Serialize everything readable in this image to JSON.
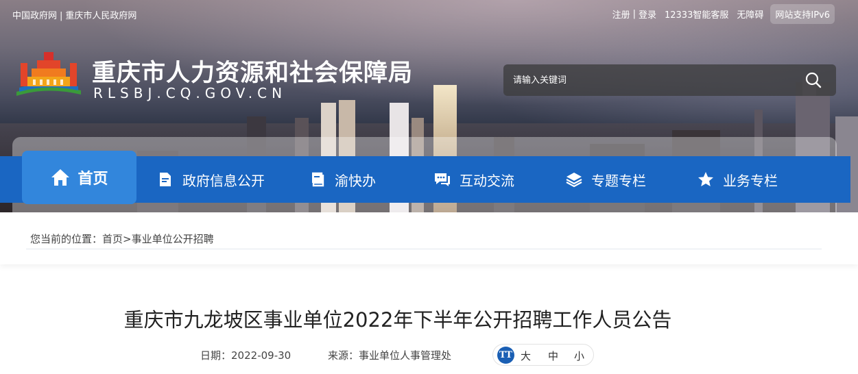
{
  "topbar": {
    "left_links": [
      "中国政府网",
      "重庆市人民政府网"
    ],
    "left_sep": "|",
    "register": "注册",
    "login": "登录",
    "right_sep": "|",
    "hotline": "12333智能客服",
    "accessibility": "无障碍",
    "ipv6": "网站支持IPv6"
  },
  "header": {
    "title": "重庆市人力资源和社会保障局",
    "domain": "RLSBJ.CQ.GOV.CN",
    "logo_icon": "government-building-logo"
  },
  "search": {
    "placeholder": "请输入关键词",
    "icon": "search-icon"
  },
  "nav": {
    "items": [
      {
        "label": "首页",
        "icon": "home-icon",
        "active": true
      },
      {
        "label": "政府信息公开",
        "icon": "document-icon"
      },
      {
        "label": "渝快办",
        "icon": "book-icon"
      },
      {
        "label": "互动交流",
        "icon": "chat-icon"
      },
      {
        "label": "专题专栏",
        "icon": "layers-icon"
      },
      {
        "label": "业务专栏",
        "icon": "star-icon"
      }
    ],
    "active_color": "#3286dc",
    "bar_color": "#1a66c2"
  },
  "breadcrumb": {
    "prefix": "您当前的位置：",
    "home": "首页",
    "sep": ">",
    "current": "事业单位公开招聘"
  },
  "article": {
    "title": "重庆市九龙坡区事业单位2022年下半年公开招聘工作人员公告",
    "date_label": "日期：",
    "date": "2022-09-30",
    "source_label": "来源：",
    "source": "事业单位人事管理处",
    "fontsize_icon_text": "TT",
    "fontsize_options": [
      "大",
      "中",
      "小"
    ]
  }
}
